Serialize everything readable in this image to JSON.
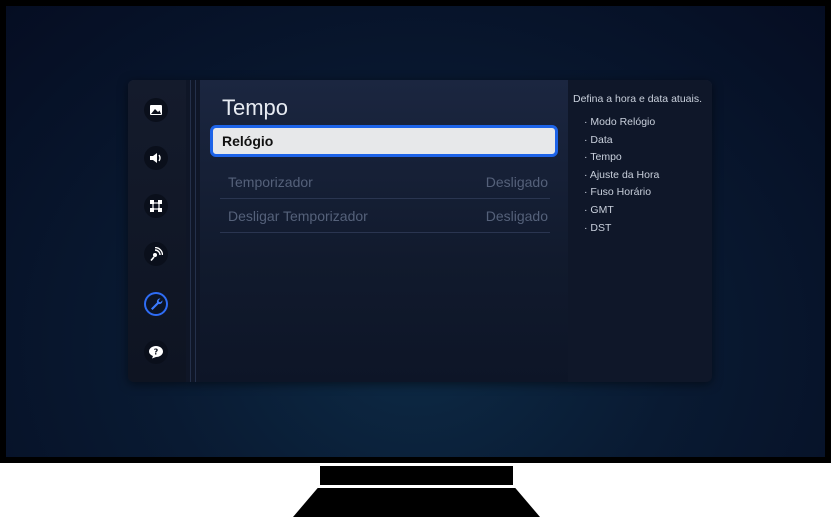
{
  "page": {
    "title": "Tempo"
  },
  "sidebar": {
    "items": [
      {
        "icon": "picture-icon",
        "active": false
      },
      {
        "icon": "sound-icon",
        "active": false
      },
      {
        "icon": "connection-icon",
        "active": false
      },
      {
        "icon": "broadcast-icon",
        "active": false
      },
      {
        "icon": "wrench-icon",
        "active": true
      },
      {
        "icon": "support-icon",
        "active": false
      }
    ]
  },
  "menu": {
    "items": [
      {
        "label": "Relógio",
        "value": "",
        "state": "selected"
      },
      {
        "label": "Temporizador",
        "value": "Desligado",
        "state": "disabled"
      },
      {
        "label": "Desligar Temporizador",
        "value": "Desligado",
        "state": "disabled"
      }
    ]
  },
  "info": {
    "description": "Defina a hora e data atuais.",
    "items": [
      "Modo Relógio",
      "Data",
      "Tempo",
      "Ajuste da Hora",
      "Fuso Horário",
      "GMT",
      "DST"
    ]
  },
  "colors": {
    "accent": "#1d63e8",
    "selected_bg": "#e7e8ea",
    "disabled_text": "#55617a"
  }
}
